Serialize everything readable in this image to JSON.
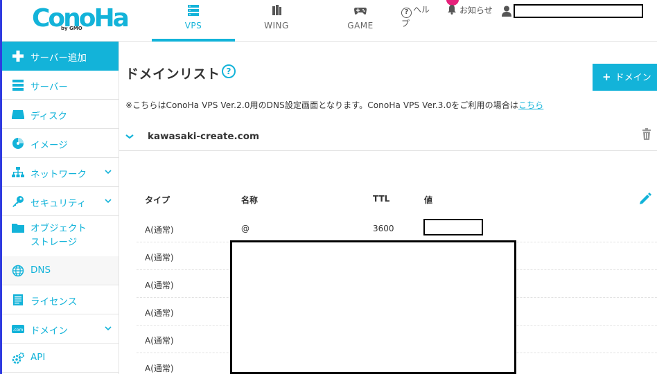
{
  "brand": {
    "logo_text": "ConoHa",
    "logo_sub": "by GMO"
  },
  "nav": {
    "tabs": [
      {
        "label": "VPS",
        "icon": "server-stack-icon",
        "active": true
      },
      {
        "label": "WING",
        "icon": "wing-icon",
        "active": false
      },
      {
        "label": "GAME",
        "icon": "gamepad-icon",
        "active": false
      }
    ],
    "help_label": "ヘルプ",
    "notice_label": "お知らせ",
    "user_name": ""
  },
  "sidebar": {
    "items": [
      {
        "label": "サーバー追加",
        "icon": "plus-icon",
        "type": "add"
      },
      {
        "label": "サーバー",
        "icon": "server-icon"
      },
      {
        "label": "ディスク",
        "icon": "disk-icon"
      },
      {
        "label": "イメージ",
        "icon": "image-icon"
      },
      {
        "label": "ネットワーク",
        "icon": "network-icon",
        "expandable": true
      },
      {
        "label": "セキュリティ",
        "icon": "key-icon",
        "expandable": true
      },
      {
        "label": "オブジェクト\nストレージ",
        "label_line1": "オブジェクト",
        "label_line2": "ストレージ",
        "icon": "folder-icon"
      },
      {
        "label": "DNS",
        "icon": "globe-icon",
        "active": true
      },
      {
        "label": "ライセンス",
        "icon": "license-icon"
      },
      {
        "label": "ドメイン",
        "icon": "domain-icon",
        "expandable": true
      },
      {
        "label": "API",
        "icon": "api-gear-icon"
      }
    ]
  },
  "main": {
    "title": "ドメインリスト",
    "add_button_label": "ドメイン",
    "note_text": "※こちらはConoHa VPS Ver.2.0用のDNS設定画面となります。ConoHa VPS Ver.3.0をご利用の場合は",
    "note_link": "こちら",
    "domain": {
      "name": "kawasaki-create.com",
      "records_header": {
        "type": "タイプ",
        "name": "名称",
        "ttl": "TTL",
        "value": "値"
      },
      "records": [
        {
          "type": "A(通常)",
          "name": "@",
          "ttl": "3600",
          "value": ""
        },
        {
          "type": "A(通常)",
          "name": "",
          "ttl": "",
          "value": ""
        },
        {
          "type": "A(通常)",
          "name": "",
          "ttl": "",
          "value": ""
        },
        {
          "type": "A(通常)",
          "name": "",
          "ttl": "",
          "value": ""
        },
        {
          "type": "A(通常)",
          "name": "",
          "ttl": "",
          "value": ""
        },
        {
          "type": "A(通常)",
          "name": "",
          "ttl": "",
          "value": ""
        }
      ]
    }
  },
  "colors": {
    "accent": "#13b3d9",
    "badge": "#e6217b"
  }
}
